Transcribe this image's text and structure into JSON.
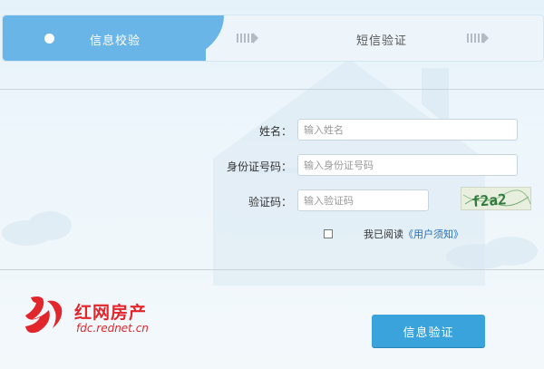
{
  "steps": {
    "step1_label": "信息校验",
    "step2_label": "短信验证"
  },
  "form": {
    "name_label": "姓名：",
    "name_placeholder": "输入姓名",
    "id_label": "身份证号码：",
    "id_placeholder": "输入身份证号码",
    "code_label": "验证码：",
    "code_placeholder": "输入验证码",
    "captcha_text": "f2a2"
  },
  "agreement": {
    "text": "我已阅读",
    "link": "《用户须知》"
  },
  "logo": {
    "title": "红网房产",
    "domain": "fdc.rednet.cn"
  },
  "submit_label": "信息验证",
  "colors": {
    "accent": "#6ab5e8",
    "button": "#3aa3dc",
    "brand_red": "#e1262c",
    "link": "#1f6fbf"
  }
}
